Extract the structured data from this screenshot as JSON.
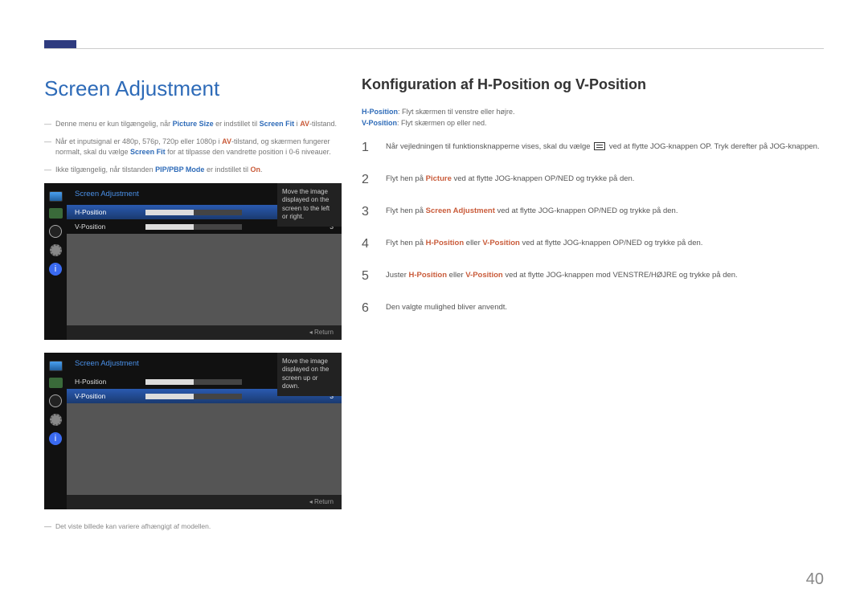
{
  "page_number": "40",
  "left": {
    "heading": "Screen Adjustment",
    "bullets": [
      {
        "parts": [
          {
            "t": "Denne menu er kun tilgængelig, når "
          },
          {
            "t": "Picture Size",
            "cls": "bold-blue"
          },
          {
            "t": " er indstillet til "
          },
          {
            "t": "Screen Fit",
            "cls": "bold-blue"
          },
          {
            "t": " i "
          },
          {
            "t": "AV",
            "cls": "bold-red"
          },
          {
            "t": "-tilstand."
          }
        ]
      },
      {
        "parts": [
          {
            "t": "Når et inputsignal er 480p, 576p, 720p eller 1080p i "
          },
          {
            "t": "AV",
            "cls": "bold-red"
          },
          {
            "t": "-tilstand, og skærmen fungerer normalt, skal du vælge "
          },
          {
            "t": "Screen Fit",
            "cls": "bold-blue"
          },
          {
            "t": " for at tilpasse den vandrette position i 0-6 niveauer."
          }
        ]
      },
      {
        "parts": [
          {
            "t": "Ikke tilgængelig, når tilstanden "
          },
          {
            "t": "PIP/PBP Mode",
            "cls": "bold-blue"
          },
          {
            "t": " er indstillet til "
          },
          {
            "t": "On",
            "cls": "bold-red"
          },
          {
            "t": "."
          }
        ]
      }
    ],
    "osd1": {
      "title": "Screen Adjustment",
      "rows": [
        {
          "label": "H-Position",
          "value": "3",
          "selected": true
        },
        {
          "label": "V-Position",
          "value": "3",
          "selected": false
        }
      ],
      "help": "Move the image displayed on the screen to the left or right.",
      "return": "Return"
    },
    "osd2": {
      "title": "Screen Adjustment",
      "rows": [
        {
          "label": "H-Position",
          "value": "3",
          "selected": false
        },
        {
          "label": "V-Position",
          "value": "3",
          "selected": true
        }
      ],
      "help": "Move the image displayed on the screen up or down.",
      "return": "Return"
    },
    "footnote": "Det viste billede kan variere afhængigt af modellen."
  },
  "right": {
    "heading": "Konfiguration af H-Position og V-Position",
    "desc": [
      {
        "parts": [
          {
            "t": "H-Position",
            "cls": "bold-blue"
          },
          {
            "t": ": Flyt skærmen til venstre eller højre."
          }
        ]
      },
      {
        "parts": [
          {
            "t": "V-Position",
            "cls": "bold-blue"
          },
          {
            "t": ": Flyt skærmen op eller ned."
          }
        ]
      }
    ],
    "steps": [
      {
        "num": "1",
        "parts": [
          {
            "t": "Når vejledningen til funktionsknapperne vises, skal du vælge "
          },
          {
            "icon": "menu"
          },
          {
            "t": " ved at flytte JOG-knappen OP. Tryk derefter på JOG-knappen."
          }
        ]
      },
      {
        "num": "2",
        "parts": [
          {
            "t": "Flyt hen på "
          },
          {
            "t": "Picture",
            "cls": "bold-red"
          },
          {
            "t": " ved at flytte JOG-knappen OP/NED og trykke på den."
          }
        ]
      },
      {
        "num": "3",
        "parts": [
          {
            "t": "Flyt hen på "
          },
          {
            "t": "Screen Adjustment",
            "cls": "bold-red"
          },
          {
            "t": " ved at flytte JOG-knappen OP/NED og trykke på den."
          }
        ]
      },
      {
        "num": "4",
        "parts": [
          {
            "t": "Flyt hen på "
          },
          {
            "t": "H-Position",
            "cls": "bold-red"
          },
          {
            "t": " eller "
          },
          {
            "t": "V-Position",
            "cls": "bold-red"
          },
          {
            "t": " ved at flytte JOG-knappen OP/NED og trykke på den."
          }
        ]
      },
      {
        "num": "5",
        "parts": [
          {
            "t": "Juster "
          },
          {
            "t": "H-Position",
            "cls": "bold-red"
          },
          {
            "t": " eller "
          },
          {
            "t": "V-Position",
            "cls": "bold-red"
          },
          {
            "t": " ved at flytte JOG-knappen mod VENSTRE/HØJRE og trykke på den."
          }
        ]
      },
      {
        "num": "6",
        "parts": [
          {
            "t": "Den valgte mulighed bliver anvendt."
          }
        ]
      }
    ]
  }
}
